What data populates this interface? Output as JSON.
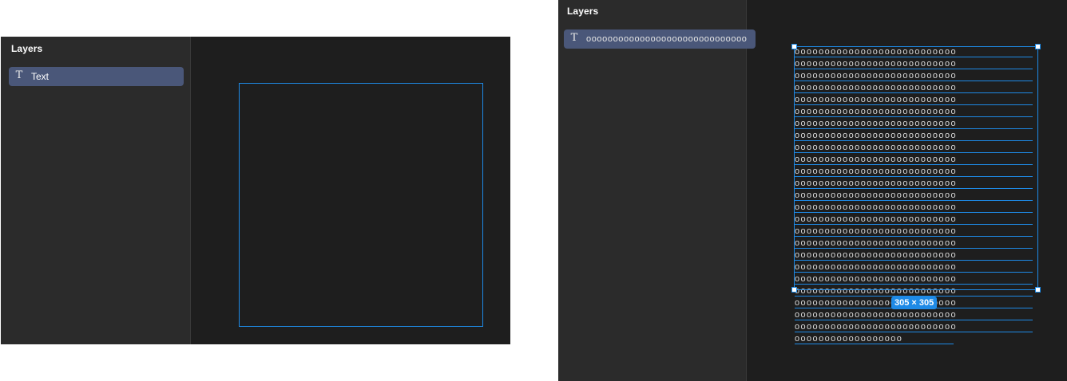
{
  "before": {
    "panel_title": "Layers",
    "layer": {
      "icon": "text-type-icon",
      "icon_glyph": "T",
      "label": "Text"
    }
  },
  "after": {
    "panel_title": "Layers",
    "layer": {
      "icon": "text-type-icon",
      "icon_glyph": "T",
      "label": "oooooooooooooooooooooooooooooo"
    },
    "text_lines": [
      "ooooooooooooooooooooooooooo",
      "ooooooooooooooooooooooooooo",
      "ooooooooooooooooooooooooooo",
      "ooooooooooooooooooooooooooo",
      "ooooooooooooooooooooooooooo",
      "ooooooooooooooooooooooooooo",
      "ooooooooooooooooooooooooooo",
      "ooooooooooooooooooooooooooo",
      "ooooooooooooooooooooooooooo",
      "ooooooooooooooooooooooooooo",
      "ooooooooooooooooooooooooooo",
      "ooooooooooooooooooooooooooo",
      "ooooooooooooooooooooooooooo",
      "ooooooooooooooooooooooooooo",
      "ooooooooooooooooooooooooooo",
      "ooooooooooooooooooooooooooo",
      "ooooooooooooooooooooooooooo",
      "ooooooooooooooooooooooooooo",
      "ooooooooooooooooooooooooooo",
      "ooooooooooooooooooooooooooo",
      "ooooooooooooooooooooooooooo",
      "ooooooooooooooooooooooooooo",
      "ooooooooooooooooooooooooooo",
      "ooooooooooooooooooooooooooo",
      "oooooooooooooooooo"
    ],
    "size_badge": "305 × 305"
  },
  "colors": {
    "canvas_bg": "#1e1e1e",
    "panel_bg": "#2b2b2b",
    "selected_row": "#4a5779",
    "selection_accent": "#1e8ae6"
  }
}
